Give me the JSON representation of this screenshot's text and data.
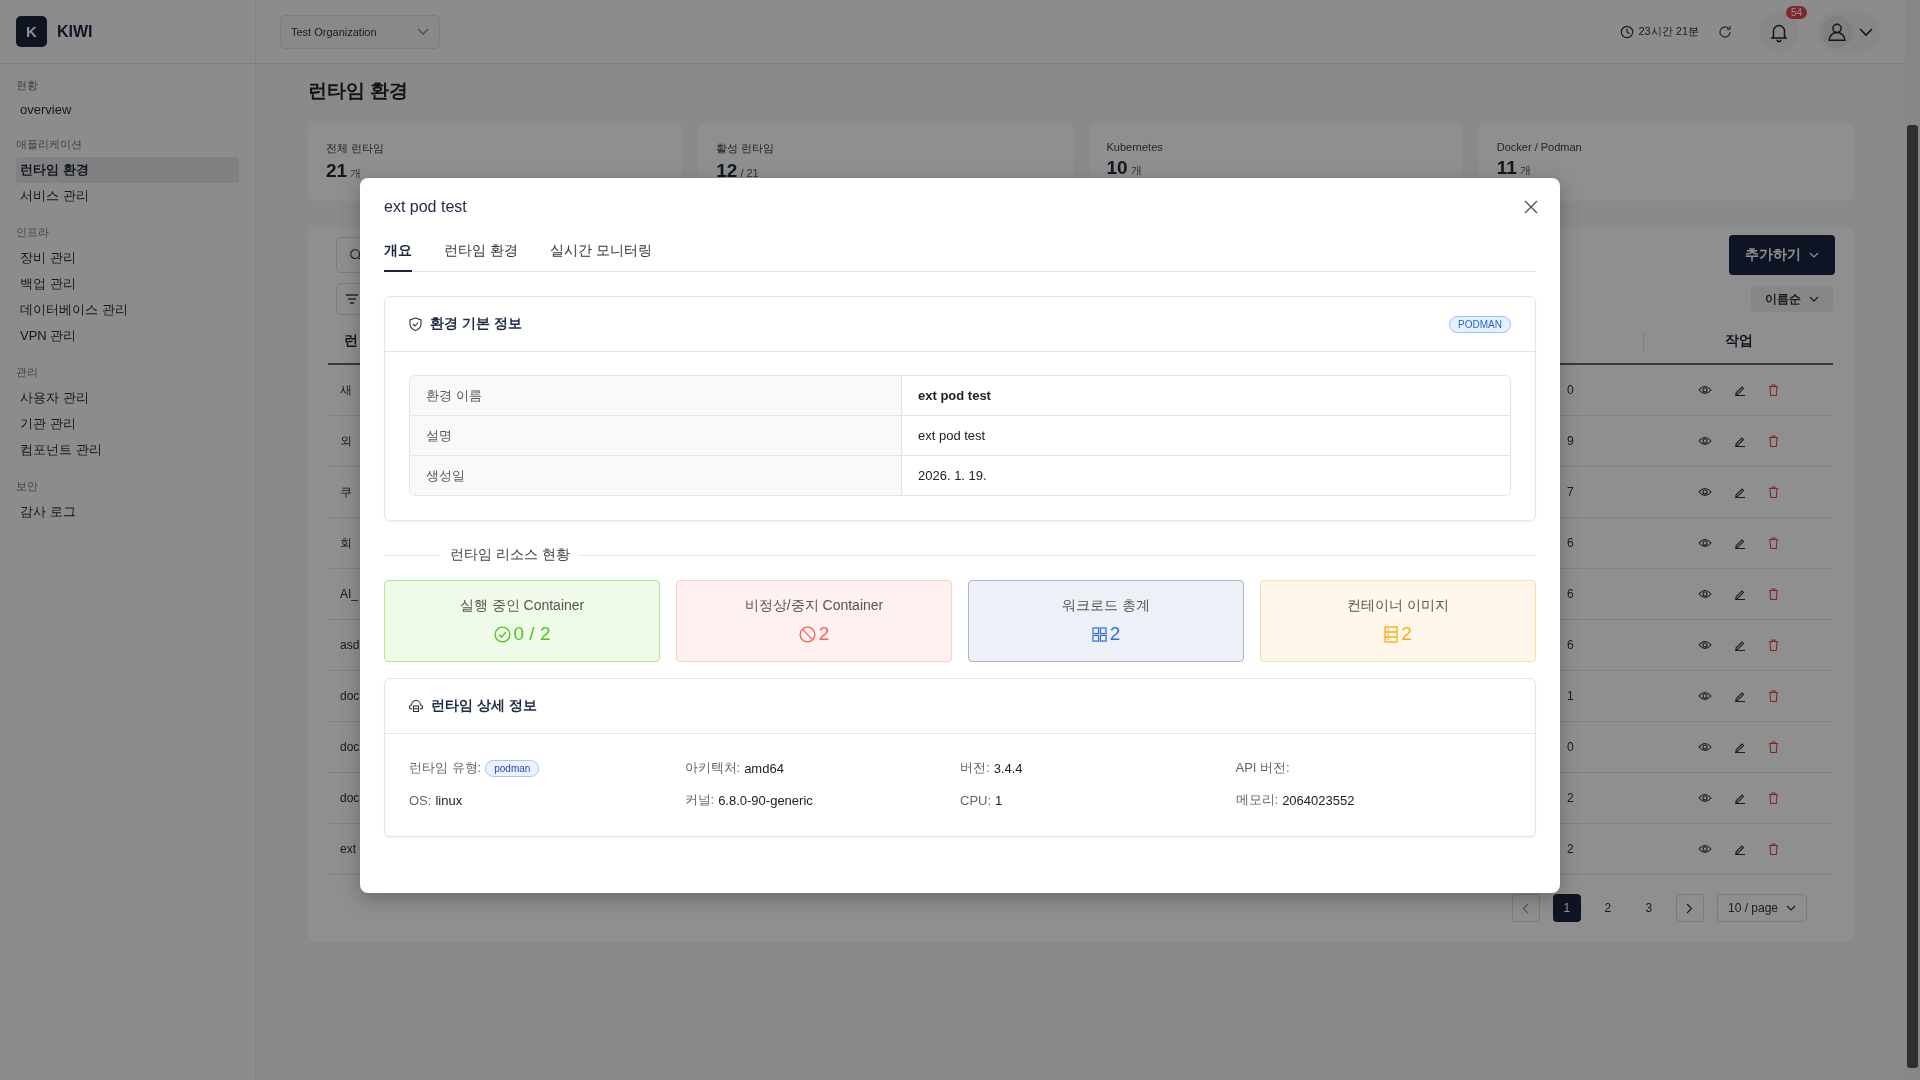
{
  "app": {
    "logo_letter": "K",
    "name": "KIWI"
  },
  "organization": "Test Organization",
  "header": {
    "session_time": "23시간 21분",
    "notifications": "54"
  },
  "sidebar": [
    {
      "heading": "현황",
      "items": [
        {
          "label": "overview",
          "selected": false
        }
      ]
    },
    {
      "heading": "애플리케이션",
      "items": [
        {
          "label": "런타임 환경",
          "selected": true
        },
        {
          "label": "서비스 관리",
          "selected": false
        }
      ]
    },
    {
      "heading": "인프라",
      "items": [
        {
          "label": "장비 관리",
          "selected": false
        },
        {
          "label": "백업 관리",
          "selected": false
        },
        {
          "label": "데이터베이스 관리",
          "selected": false
        },
        {
          "label": "VPN 관리",
          "selected": false
        }
      ]
    },
    {
      "heading": "관리",
      "items": [
        {
          "label": "사용자 관리",
          "selected": false
        },
        {
          "label": "기관 관리",
          "selected": false
        },
        {
          "label": "컴포넌트 관리",
          "selected": false
        }
      ]
    },
    {
      "heading": "보안",
      "items": [
        {
          "label": "감사 로그",
          "selected": false
        }
      ]
    }
  ],
  "page": {
    "title": "런타임 환경",
    "stats": [
      {
        "label": "전체 런타임",
        "value": "21",
        "unit": "개"
      },
      {
        "label": "활성 런타임",
        "value": "12",
        "unit": "/ 21"
      },
      {
        "label": "Kubernetes",
        "value": "10",
        "unit": "개"
      },
      {
        "label": "Docker / Podman",
        "value": "11",
        "unit": "개"
      }
    ]
  },
  "toolbar": {
    "add_button": "추가하기",
    "sort": "이름순"
  },
  "table": {
    "columns": [
      "런",
      "작업"
    ],
    "rows": [
      {
        "column_1": "새",
        "column_2": "0"
      },
      {
        "column_1": "외",
        "column_2": "9"
      },
      {
        "column_1": "쿠",
        "column_2": "7"
      },
      {
        "column_1": "회",
        "column_2": "6"
      },
      {
        "column_1": "AI_",
        "column_2": "6"
      },
      {
        "column_1": "asd",
        "column_2": "6"
      },
      {
        "column_1": "doc",
        "column_2": "1"
      },
      {
        "column_1": "doc",
        "column_2": "0"
      },
      {
        "column_1": "doc",
        "column_2": "2"
      },
      {
        "column_1": "ext",
        "column_2": "2"
      }
    ]
  },
  "pagination": {
    "pages": [
      {
        "label": "1",
        "selected": true
      },
      {
        "label": "2",
        "selected": false
      },
      {
        "label": "3",
        "selected": false
      }
    ],
    "page_size": "10 / page"
  },
  "modal": {
    "title": "ext pod test",
    "tabs": [
      {
        "label": "개요",
        "selected": true
      },
      {
        "label": "런타임 환경",
        "selected": false
      },
      {
        "label": "실시간 모니터링",
        "selected": false
      }
    ],
    "basic_info": {
      "title": "환경 기본 정보",
      "badge": "PODMAN",
      "rows": [
        {
          "label": "환경 이름",
          "value": "ext pod test",
          "bold": true
        },
        {
          "label": "설명",
          "value": "ext pod test",
          "bold": false
        },
        {
          "label": "생성일",
          "value": "2026. 1. 19.",
          "bold": false
        }
      ]
    },
    "resources": {
      "title": "런타임 리소스 현황",
      "tiles": [
        {
          "kind": "running",
          "label": "실행 중인 Container",
          "value": "0 / 2"
        },
        {
          "kind": "stopped",
          "label": "비정상/중지 Container",
          "value": "2"
        },
        {
          "kind": "workload",
          "label": "워크로드 총계",
          "value": "2"
        },
        {
          "kind": "image",
          "label": "컨테이너 이미지",
          "value": "2"
        }
      ]
    },
    "details": {
      "title": "런타임 상세 정보",
      "fields": [
        {
          "label": "런타임 유형:",
          "value": "podman",
          "kind": "tag"
        },
        {
          "label": "아키텍처:",
          "value": "amd64",
          "kind": "text"
        },
        {
          "label": "버전:",
          "value": "3.4.4",
          "kind": "text"
        },
        {
          "label": "API 버전:",
          "kind": "text"
        },
        {
          "label": "OS:",
          "value": "linux",
          "kind": "text"
        },
        {
          "label": "커널:",
          "value": "6.8.0-90-generic",
          "kind": "text"
        },
        {
          "label": "CPU:",
          "value": "1",
          "kind": "text"
        },
        {
          "label": "메모리:",
          "value": "2064023552",
          "kind": "text"
        }
      ]
    }
  }
}
